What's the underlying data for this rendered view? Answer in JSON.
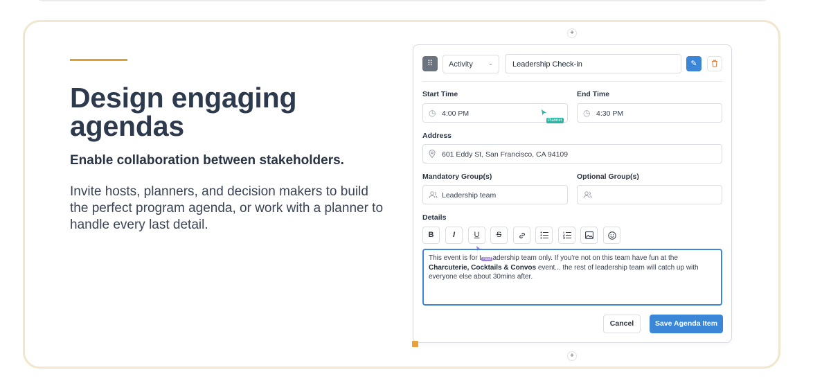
{
  "headline": "Design engaging agendas",
  "subheadline": "Enable collaboration between stakeholders.",
  "body": "Invite hosts, planners, and decision makers to build the perfect program agenda, or work with a planner to handle every last detail.",
  "form": {
    "type_select": "Activity",
    "title": "Leadership Check-in",
    "start_time_label": "Start Time",
    "start_time": "4:00 PM",
    "end_time_label": "End Time",
    "end_time": "4:30 PM",
    "address_label": "Address",
    "address": "601 Eddy St, San Francisco, CA 94109",
    "mandatory_label": "Mandatory Group(s)",
    "mandatory": "Leadership team",
    "optional_label": "Optional Group(s)",
    "optional": "",
    "details_label": "Details",
    "details_part1": "This event is for t",
    "details_part2": "adership team only. If you're not on this team have fun at the",
    "details_bold": "Charcuterie, Cocktails & Convos",
    "details_part3": " event... the rest of leadership team will catch up with everyone else about 30mins after.",
    "cancel": "Cancel",
    "save": "Save Agenda Item"
  },
  "cursors": {
    "planner": "Planner",
    "host": "Host"
  },
  "icons": {
    "drag": "drag-handle-icon",
    "edit": "pencil-icon",
    "delete": "trash-icon",
    "clock": "clock-icon",
    "location": "map-pin-icon",
    "users": "users-icon",
    "plus": "plus-icon"
  },
  "colors": {
    "accent": "#d9a23a",
    "card_border": "#f1e7cf",
    "primary": "#3b86d6",
    "planner_cursor": "#2bb5a4",
    "host_cursor": "#9b7fe0"
  }
}
